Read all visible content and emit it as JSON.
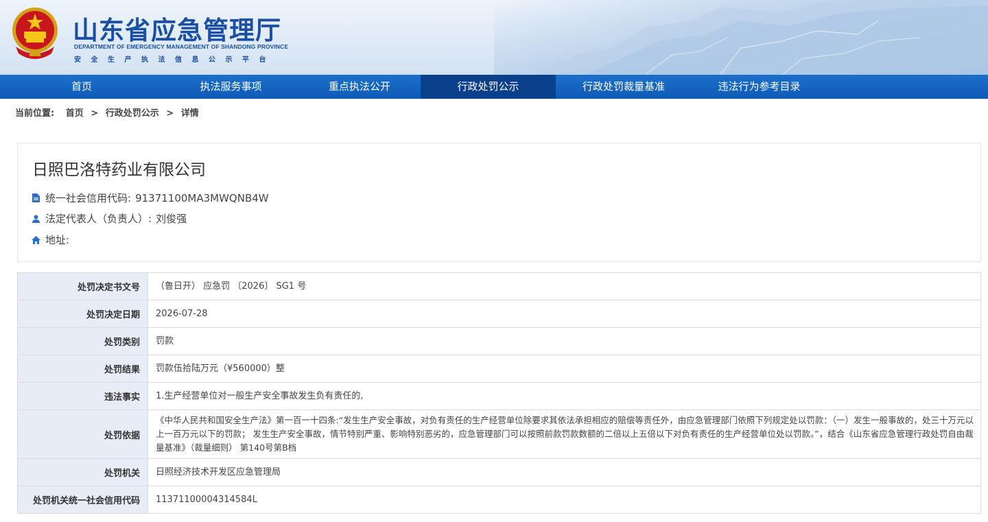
{
  "header": {
    "title": "山东省应急管理厅",
    "subtitle_en": "DEPARTMENT OF EMERGENCY MANAGEMENT OF SHANDONG PROVINCE",
    "subtitle_cn": "安全生产执法信息公示平台",
    "emblem_icon": "national-emblem-icon"
  },
  "nav": {
    "items": [
      {
        "label": "首页",
        "active": false
      },
      {
        "label": "执法服务事项",
        "active": false
      },
      {
        "label": "重点执法公开",
        "active": false
      },
      {
        "label": "行政处罚公示",
        "active": true
      },
      {
        "label": "行政处罚裁量基准",
        "active": false
      },
      {
        "label": "违法行为参考目录",
        "active": false
      }
    ]
  },
  "breadcrumb": {
    "prefix": "当前位置:",
    "items": [
      "首页",
      "行政处罚公示",
      "详情"
    ],
    "separator": ">"
  },
  "company": {
    "name": "日照巴洛特药业有限公司",
    "credit_code_label": "统一社会信用代码:",
    "credit_code": "91371100MA3MWQNB4W",
    "legal_rep_label": "法定代表人（负责人）:",
    "legal_rep": "刘俊强",
    "address_label": "地址:",
    "address": ""
  },
  "details": [
    {
      "key": "处罚决定书文号",
      "value": "（鲁日开） 应急罚 〔2026〕 SG1 号"
    },
    {
      "key": "处罚决定日期",
      "value": "2026-07-28"
    },
    {
      "key": "处罚类别",
      "value": "罚款"
    },
    {
      "key": "处罚结果",
      "value": "罚款伍拾陆万元（¥560000）整"
    },
    {
      "key": "违法事实",
      "value": "1.生产经营单位对一般生产安全事故发生负有责任的,"
    },
    {
      "key": "处罚依据",
      "value": "《中华人民共和国安全生产法》第一百一十四条:“发生生产安全事故，对负有责任的生产经营单位除要求其依法承担相应的赔偿等责任外，由应急管理部门依照下列规定处以罚款：（一）发生一般事故的，处三十万元以上一百万元以下的罚款； 发生生产安全事故，情节特别严重、影响特别恶劣的，应急管理部门可以按照前款罚款数额的二倍以上五倍以下对负有责任的生产经营单位处以罚款。”，结合《山东省应急管理行政处罚自由裁量基准》（裁量细则） 第140号第B档"
    },
    {
      "key": "处罚机关",
      "value": "日照经济技术开发区应急管理局"
    },
    {
      "key": "处罚机关统一社会信用代码",
      "value": "11371100004314584L"
    }
  ],
  "colors": {
    "nav_bg": "#1565c0",
    "nav_active": "#0a3f8c",
    "title_blue": "#1a4fa3",
    "label_bg": "#e8ecf6",
    "icon_blue": "#2a6fc9"
  }
}
